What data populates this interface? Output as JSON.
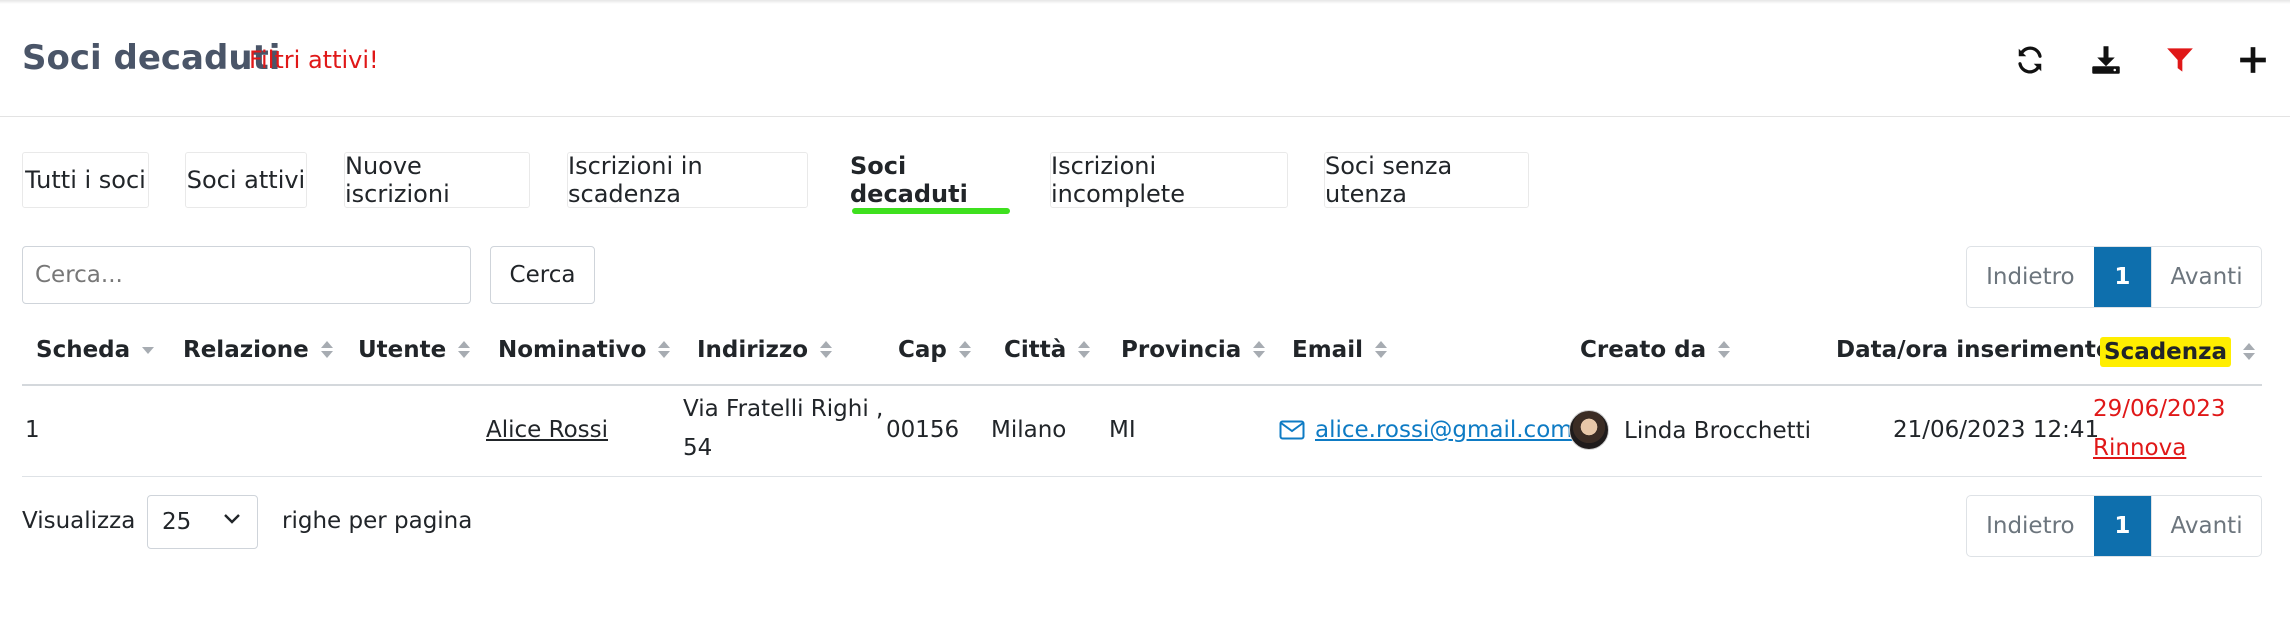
{
  "header": {
    "title": "Soci decaduti",
    "filters_notice": "Filtri attivi!",
    "actions": [
      {
        "name": "refresh-icon",
        "color": "#111111"
      },
      {
        "name": "download-icon",
        "color": "#111111"
      },
      {
        "name": "filter-icon",
        "color": "#e01818"
      },
      {
        "name": "plus-icon",
        "color": "#111111"
      }
    ]
  },
  "tabs": [
    {
      "label": "Tutti i soci"
    },
    {
      "label": "Soci attivi"
    },
    {
      "label": "Nuove iscrizioni"
    },
    {
      "label": "Iscrizioni in scadenza"
    },
    {
      "label": "Soci decaduti",
      "active": true
    },
    {
      "label": "Iscrizioni incomplete"
    },
    {
      "label": "Soci senza utenza"
    }
  ],
  "search": {
    "placeholder": "Cerca...",
    "value": "",
    "button_label": "Cerca"
  },
  "pagination": {
    "prev_label": "Indietro",
    "current_page": "1",
    "next_label": "Avanti"
  },
  "table": {
    "columns": [
      "Scheda",
      "Relazione",
      "Utente",
      "Nominativo",
      "Indirizzo",
      "Cap",
      "Città",
      "Provincia",
      "Email",
      "Creato da",
      "Data/ora inserimento",
      "Scadenza"
    ],
    "rows": [
      {
        "scheda": "1",
        "relazione": "",
        "utente": "",
        "nominativo": "Alice Rossi",
        "indirizzo_line1": "Via Fratelli Righi ,",
        "indirizzo_line2": "54",
        "cap": "00156",
        "citta": "Milano",
        "provincia": "MI",
        "email": "alice.rossi@gmail.com",
        "creato_da": "Linda Brocchetti",
        "data_ora": "21/06/2023 12:41",
        "scadenza": "29/06/2023",
        "rinnova_label": "Rinnova"
      }
    ]
  },
  "footer": {
    "show_label": "Visualizza",
    "page_size": "25",
    "rows_per_page_label": "righe per pagina"
  },
  "colors": {
    "accent": "#0e6fad",
    "active_tab_underline": "#3ee01e",
    "alert_red": "#e01818",
    "highlight": "#ffee00",
    "email_link": "#0e7bc4"
  }
}
